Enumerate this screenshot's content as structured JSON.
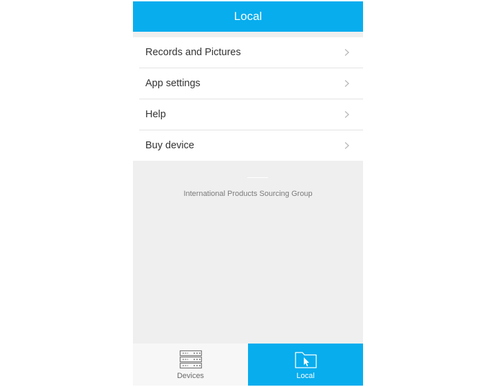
{
  "header": {
    "title": "Local"
  },
  "menu": {
    "items": [
      {
        "label": "Records and Pictures",
        "icon": "chevron-right-icon"
      },
      {
        "label": "App settings",
        "icon": "chevron-right-icon"
      },
      {
        "label": "Help",
        "icon": "chevron-right-icon"
      },
      {
        "label": "Buy device",
        "icon": "chevron-right-icon"
      }
    ]
  },
  "footer": {
    "company": "International Products Sourcing Group"
  },
  "tabbar": {
    "tabs": [
      {
        "label": "Devices",
        "icon": "server-rack-icon",
        "active": false
      },
      {
        "label": "Local",
        "icon": "folder-cursor-icon",
        "active": true
      }
    ]
  },
  "colors": {
    "accent": "#08adee",
    "background": "#efefef",
    "text": "#333333"
  }
}
